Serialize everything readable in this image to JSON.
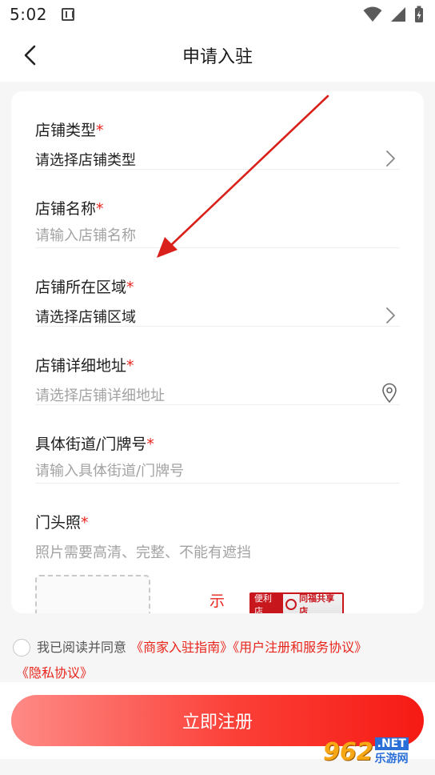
{
  "status_bar": {
    "time": "5:02"
  },
  "nav": {
    "title": "申请入驻"
  },
  "form": {
    "shop_type": {
      "label": "店铺类型",
      "required_mark": "*",
      "value": "请选择店铺类型"
    },
    "shop_name": {
      "label": "店铺名称",
      "required_mark": "*",
      "placeholder": "请输入店铺名称"
    },
    "shop_region": {
      "label": "店铺所在区域",
      "required_mark": "*",
      "value": "请选择店铺区域"
    },
    "shop_address": {
      "label": "店铺详细地址",
      "required_mark": "*",
      "value": "请选择店铺详细地址"
    },
    "street": {
      "label": "具体街道/门牌号",
      "required_mark": "*",
      "placeholder": "请输入具体街道/门牌号"
    },
    "storefront_photo": {
      "label": "门头照",
      "required_mark": "*",
      "hint": "照片需要高清、完整、不能有遮挡",
      "sample_label": "示"
    },
    "sample_sign": {
      "left_text": "便利店",
      "right_text": "同福共享店"
    }
  },
  "agreement": {
    "prefix": "我已阅读并同意",
    "link_guide": "《商家入驻指南》",
    "link_terms": "《用户注册和服务协议》",
    "link_privacy": "《隐私协议》"
  },
  "submit": {
    "label": "立即注册"
  },
  "watermark": {
    "number": "962",
    "domain": ".NET",
    "cn": "乐游网"
  },
  "colors": {
    "accent": "#e8241b",
    "button_start": "#fe8a86",
    "button_end": "#f61a14"
  }
}
